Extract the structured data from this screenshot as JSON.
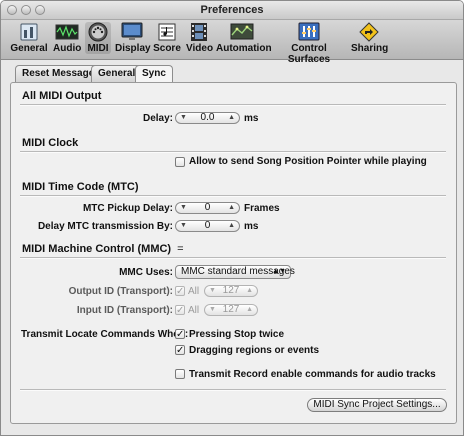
{
  "window": {
    "title": "Preferences"
  },
  "toolbar": {
    "items": [
      {
        "label": "General",
        "icon": "general-icon"
      },
      {
        "label": "Audio",
        "icon": "audio-icon"
      },
      {
        "label": "MIDI",
        "icon": "midi-icon"
      },
      {
        "label": "Display",
        "icon": "display-icon"
      },
      {
        "label": "Score",
        "icon": "score-icon"
      },
      {
        "label": "Video",
        "icon": "video-icon"
      },
      {
        "label": "Automation",
        "icon": "automation-icon"
      },
      {
        "label": "Control Surfaces",
        "icon": "control-surfaces-icon"
      },
      {
        "label": "Sharing",
        "icon": "sharing-icon"
      }
    ]
  },
  "tabs": [
    {
      "label": "Reset Messages"
    },
    {
      "label": "General"
    },
    {
      "label": "Sync"
    }
  ],
  "sections": {
    "all_midi_output": {
      "title": "All MIDI Output",
      "delay_label": "Delay:",
      "delay_value": "0.0",
      "delay_unit": "ms"
    },
    "midi_clock": {
      "title": "MIDI Clock",
      "allow_spp_label": "Allow to send Song Position Pointer while playing"
    },
    "mtc": {
      "title": "MIDI Time Code (MTC)",
      "pickup_delay_label": "MTC Pickup Delay:",
      "pickup_delay_value": "0",
      "pickup_delay_unit": "Frames",
      "delay_transmission_label": "Delay MTC transmission By:",
      "delay_transmission_value": "0",
      "delay_transmission_unit": "ms"
    },
    "mmc": {
      "title": "MIDI Machine Control (MMC)",
      "title_mark": "=",
      "uses_label": "MMC Uses:",
      "uses_value": "MMC standard messages",
      "output_id_label": "Output ID (Transport):",
      "output_id_all": "All",
      "output_id_value": "127",
      "input_id_label": "Input ID (Transport):",
      "input_id_all": "All",
      "input_id_value": "127",
      "transmit_locate_label": "Transmit Locate Commands When:",
      "pressing_stop_label": "Pressing Stop twice",
      "dragging_regions_label": "Dragging regions or events",
      "transmit_record_label": "Transmit Record enable commands for audio tracks"
    }
  },
  "footer": {
    "project_settings_button": "MIDI Sync Project Settings..."
  },
  "colors": {
    "window_bg": "#e8e8e8",
    "panel_bg": "#f0f0f0",
    "toolbar_bg": "#c7c7c7"
  }
}
